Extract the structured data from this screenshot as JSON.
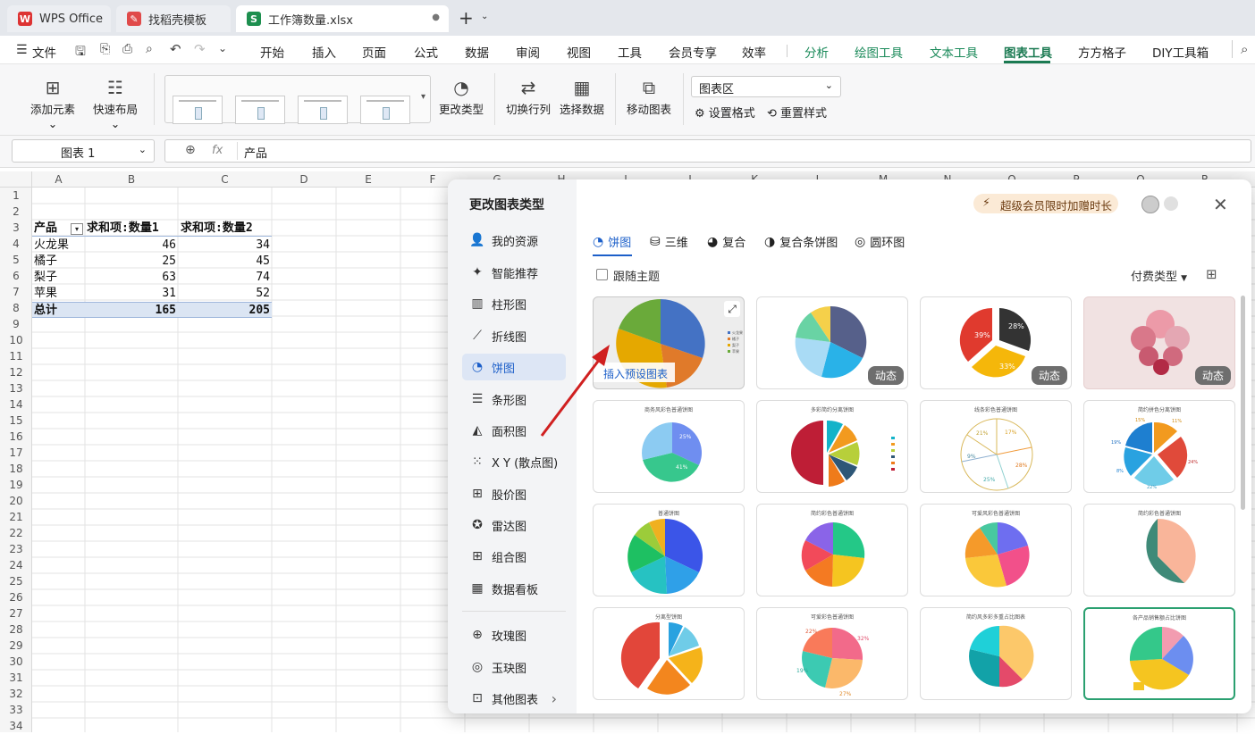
{
  "tabs": [
    {
      "label": "WPS Office",
      "color": "#d33"
    },
    {
      "label": "找稻壳模板",
      "color": "#e04a4a"
    },
    {
      "label": "工作簿数量.xlsx",
      "color": "#1d8f4f"
    }
  ],
  "new_tab": "+",
  "menu": {
    "file": "文件",
    "items": [
      "开始",
      "插入",
      "页面",
      "公式",
      "数据",
      "审阅",
      "视图",
      "工具",
      "会员专享",
      "效率"
    ],
    "accent": [
      "分析",
      "绘图工具",
      "文本工具"
    ],
    "active": "图表工具",
    "tail": [
      "方方格子",
      "DIY工具箱"
    ]
  },
  "toolbar": {
    "add_element": "添加元素",
    "quick_layout": "快速布局",
    "change_type": "更改类型",
    "switch_rowcol": "切换行列",
    "select_data": "选择数据",
    "move_chart": "移动图表",
    "area_select": "图表区",
    "set_format": "设置格式",
    "reset_style": "重置样式"
  },
  "formula": {
    "name_box": "图表 1",
    "fx": "fx",
    "value": "产品"
  },
  "columns": [
    "A",
    "B",
    "C",
    "D",
    "E",
    "F",
    "G",
    "H",
    "I",
    "J",
    "K",
    "L",
    "M",
    "N",
    "O",
    "P",
    "Q",
    "R"
  ],
  "rows": [
    "1",
    "2",
    "3",
    "4",
    "5",
    "6",
    "7",
    "8",
    "9",
    "10",
    "11",
    "12",
    "13",
    "14",
    "15",
    "16",
    "17",
    "18",
    "19",
    "20",
    "21",
    "22",
    "23",
    "24",
    "25",
    "26",
    "27",
    "28",
    "29",
    "30",
    "31",
    "32",
    "33",
    "34"
  ],
  "pivot": {
    "headers": [
      "产品",
      "求和项:数量1",
      "求和项:数量2"
    ],
    "data": [
      [
        "火龙果",
        "46",
        "34"
      ],
      [
        "橘子",
        "25",
        "45"
      ],
      [
        "梨子",
        "63",
        "74"
      ],
      [
        "苹果",
        "31",
        "52"
      ]
    ],
    "total": [
      "总计",
      "165",
      "205"
    ]
  },
  "dialog": {
    "title": "更改图表类型",
    "promo": "超级会员限时加赠时长",
    "nav": [
      "我的资源",
      "智能推荐",
      "柱形图",
      "折线图",
      "饼图",
      "条形图",
      "面积图",
      "X Y (散点图)",
      "股价图",
      "雷达图",
      "组合图",
      "数据看板",
      "玫瑰图",
      "玉玦图",
      "其他图表"
    ],
    "nav_icons": [
      "👤",
      "✦",
      "▥",
      "⟋",
      "◔",
      "☰",
      "◭",
      "⁙",
      "⊞",
      "✪",
      "⊞",
      "▦",
      "⊕",
      "◎",
      "⊡"
    ],
    "chart_tabs": [
      "饼图",
      "三维",
      "复合",
      "复合条饼图",
      "圆环图"
    ],
    "follow_theme": "跟随主题",
    "pay_type": "付费类型",
    "insert_tip": "插入预设图表",
    "dynamic": "动态",
    "legend1": [
      "火龙果",
      "橘子",
      "梨子",
      "苹果"
    ],
    "card_titles": [
      "商务风彩色普通饼图",
      "多彩简约分离饼图",
      "线条彩色普通饼图",
      "简约拼色分离饼图",
      "普通饼图",
      "简约彩色普通饼图",
      "可爱风彩色普通饼图",
      "简约彩色普通饼图",
      "分离型饼图",
      "可爱彩色普通饼图",
      "简约风多彩多重占比图表",
      "各产品销售额占比饼图"
    ],
    "pct_labels": {
      "c3": [
        "39%",
        "28%",
        "33%"
      ],
      "c6": [
        "17%",
        "28%",
        "25%",
        "9%",
        "21%"
      ],
      "c8": [
        "15%",
        "11%",
        "24%",
        "22%",
        "8%",
        "19%"
      ],
      "c14": [
        "22%",
        "32%",
        "27%",
        "19%"
      ],
      "c9": [
        "25%",
        "41%"
      ]
    }
  },
  "colors": {
    "accent": "#1b7a52",
    "blue": "#1c5fc9",
    "arrow": "#d02020"
  }
}
